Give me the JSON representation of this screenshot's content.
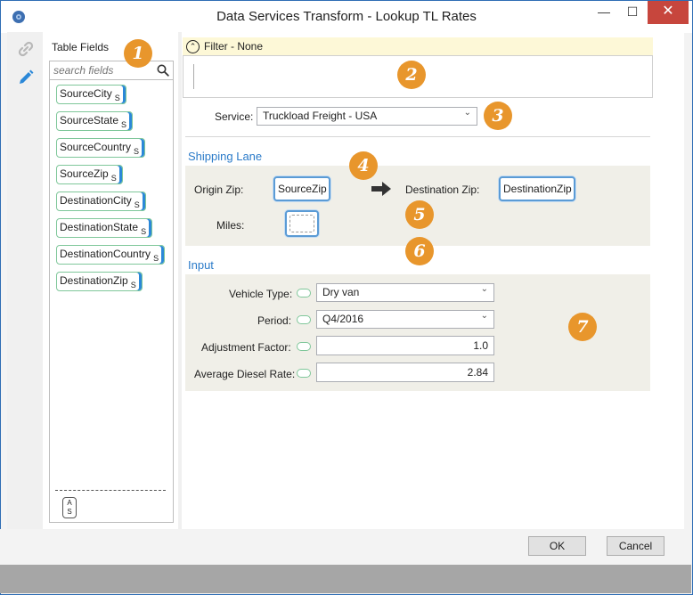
{
  "window": {
    "title": "Data Services Transform - Lookup TL Rates",
    "controls": {
      "minimize": "—",
      "maximize": "☐",
      "close": "✕"
    }
  },
  "sidebar": {
    "tools": [
      {
        "name": "link-icon",
        "active": false
      },
      {
        "name": "pencil-icon",
        "active": true
      }
    ]
  },
  "fields": {
    "label": "Table Fields",
    "search_placeholder": "search fields",
    "items": [
      {
        "name": "SourceCity",
        "type": "S"
      },
      {
        "name": "SourceState",
        "type": "S"
      },
      {
        "name": "SourceCountry",
        "type": "S"
      },
      {
        "name": "SourceZip",
        "type": "S"
      },
      {
        "name": "DestinationCity",
        "type": "S"
      },
      {
        "name": "DestinationState",
        "type": "S"
      },
      {
        "name": "DestinationCountry",
        "type": "S"
      },
      {
        "name": "DestinationZip",
        "type": "S"
      }
    ],
    "sort_toggle": {
      "top": "A",
      "bottom": "S"
    }
  },
  "filter": {
    "label": "Filter - None",
    "toggle_glyph": "⌃"
  },
  "service": {
    "label": "Service:",
    "value": "Truckload Freight - USA"
  },
  "shipping_lane": {
    "title": "Shipping Lane",
    "origin_label": "Origin Zip:",
    "origin_value": "SourceZip",
    "destination_label": "Destination Zip:",
    "destination_value": "DestinationZip",
    "miles_label": "Miles:"
  },
  "input": {
    "title": "Input",
    "vehicle_type": {
      "label": "Vehicle Type:",
      "value": "Dry van"
    },
    "period": {
      "label": "Period:",
      "value": "Q4/2016"
    },
    "adjustment_factor": {
      "label": "Adjustment Factor:",
      "value": "1.0"
    },
    "average_diesel_rate": {
      "label": "Average Diesel Rate:",
      "value": "2.84"
    }
  },
  "callouts": [
    "1",
    "2",
    "3",
    "4",
    "5",
    "6",
    "7"
  ],
  "buttons": {
    "ok": "OK",
    "cancel": "Cancel"
  },
  "colors": {
    "accent": "#2b7bc9",
    "callout": "#e8962c",
    "filter_bar": "#fdf8d7",
    "chip_border": "#7fc79a",
    "close_button": "#c7463d"
  }
}
